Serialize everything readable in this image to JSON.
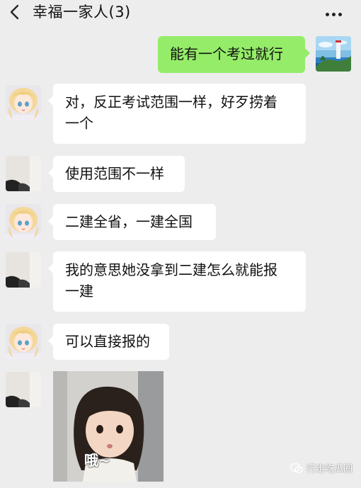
{
  "header": {
    "title": "幸福一家人(3)",
    "back_icon": "chevron-left-icon",
    "more_icon": "more-horizontal-icon"
  },
  "messages": [
    {
      "sender": "me",
      "text": "能有一个考过就行"
    },
    {
      "sender": "blonde-anime-avatar",
      "text_lines": [
        "对，反正考试范围一样，好歹捞着",
        "一个"
      ]
    },
    {
      "sender": "room-photo-avatar",
      "text": "使用范围不一样"
    },
    {
      "sender": "blonde-anime-avatar",
      "text": "二建全省，一建全国"
    },
    {
      "sender": "room-photo-avatar",
      "text_lines": [
        "我的意思她没拿到二建怎么就能报",
        "一建"
      ]
    },
    {
      "sender": "blonde-anime-avatar",
      "text": "可以直接报的"
    },
    {
      "sender": "room-photo-avatar",
      "sticker_caption": "哦~"
    }
  ],
  "watermark": {
    "text": "行走吃瓜圈",
    "icon": "wechat-logo-icon"
  },
  "colors": {
    "background": "#ededed",
    "my_bubble": "#95ec69",
    "other_bubble": "#ffffff"
  }
}
